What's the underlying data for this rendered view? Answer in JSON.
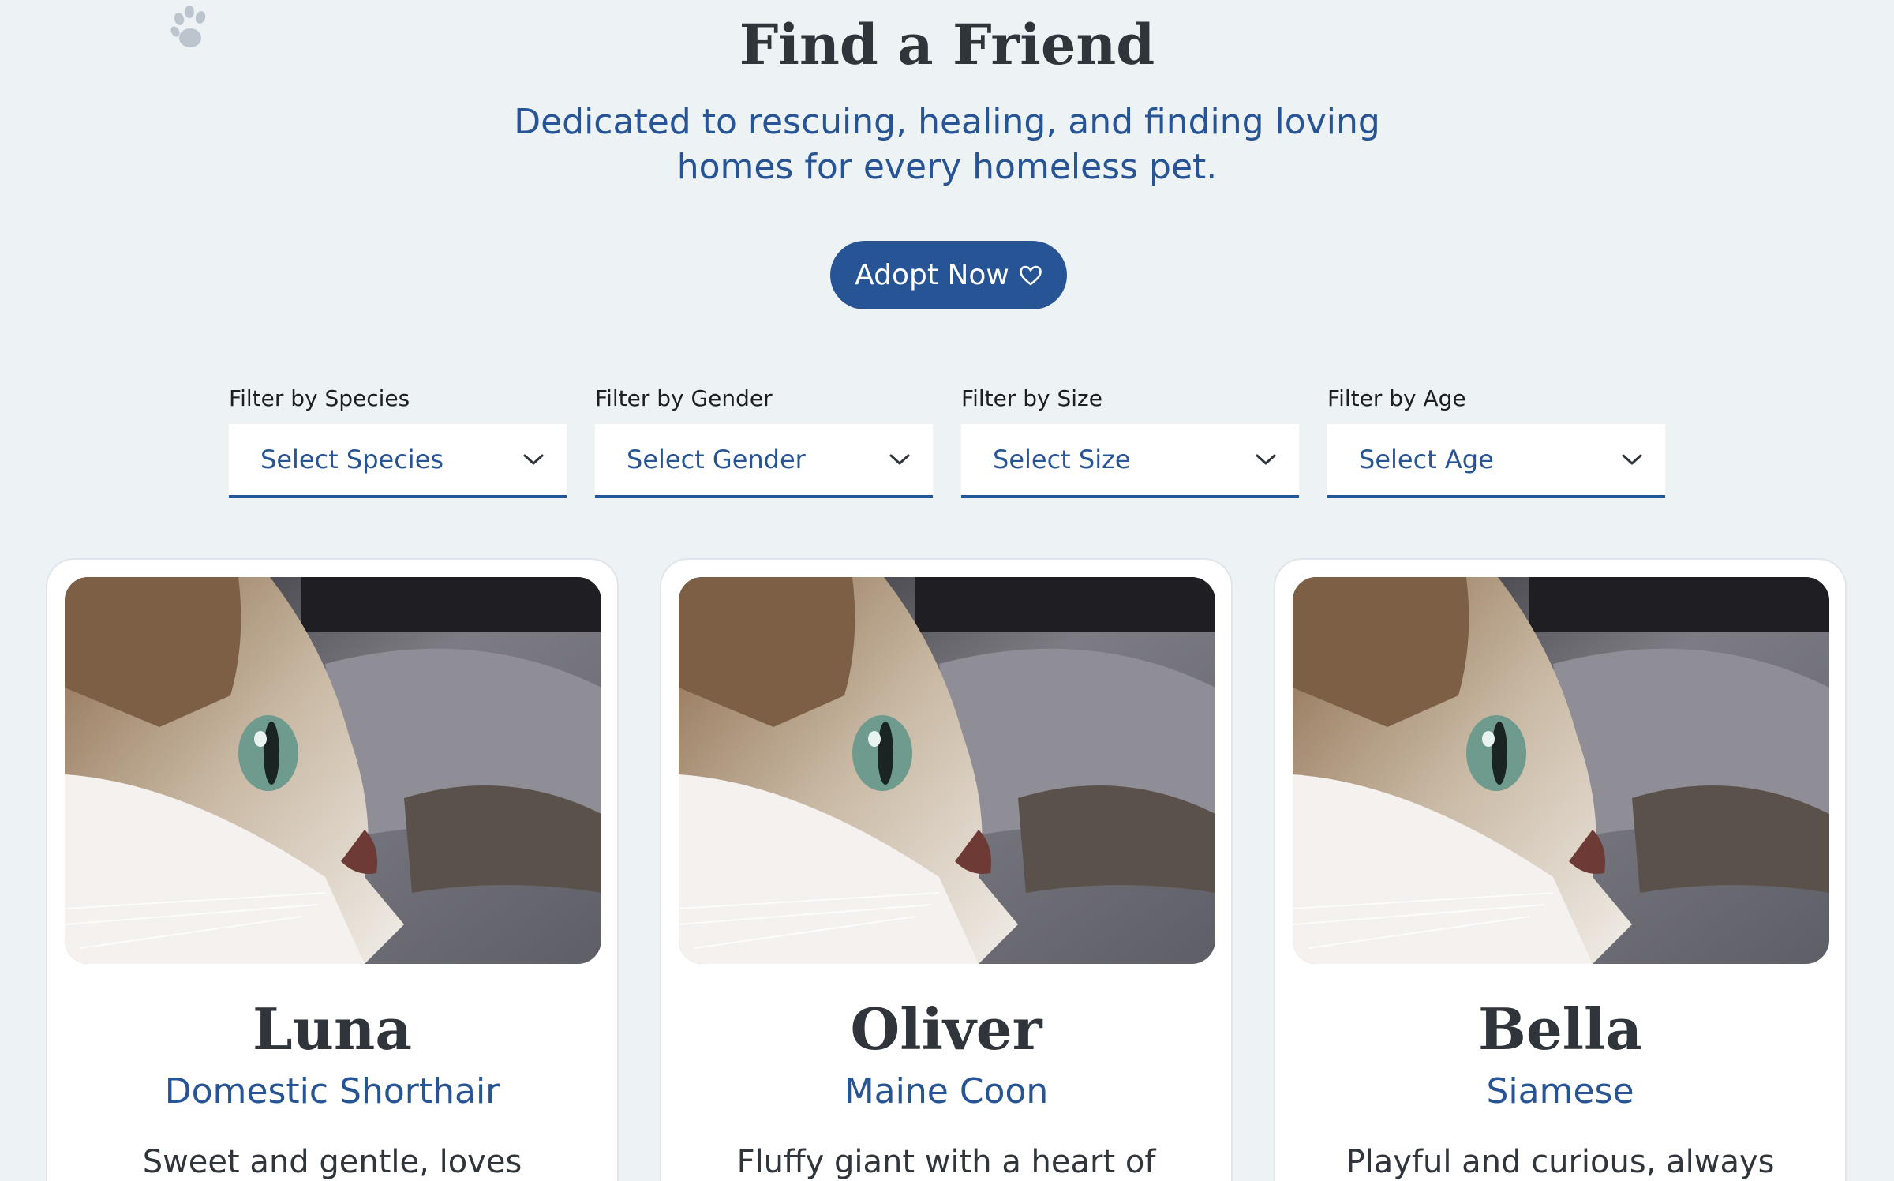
{
  "hero": {
    "title": "Find a Friend",
    "subtitle": "Dedicated to rescuing, healing, and finding loving homes for every homeless pet.",
    "adopt_button": "Adopt Now",
    "adopt_icon": "heart-outline-icon",
    "decor_icon": "paw-print-icon"
  },
  "filters": [
    {
      "label": "Filter by Species",
      "value": "Select Species"
    },
    {
      "label": "Filter by Gender",
      "value": "Select Gender"
    },
    {
      "label": "Filter by Size",
      "value": "Select Size"
    },
    {
      "label": "Filter by Age",
      "value": "Select Age"
    }
  ],
  "pets": [
    {
      "name": "Luna",
      "breed": "Domestic Shorthair",
      "description": "Sweet and gentle, loves"
    },
    {
      "name": "Oliver",
      "breed": "Maine Coon",
      "description": "Fluffy giant with a heart of"
    },
    {
      "name": "Bella",
      "breed": "Siamese",
      "description": "Playful and curious, always"
    }
  ],
  "colors": {
    "background": "#edf2f5",
    "accent": "#275494",
    "heading": "#2f353b",
    "card": "#ffffff"
  }
}
